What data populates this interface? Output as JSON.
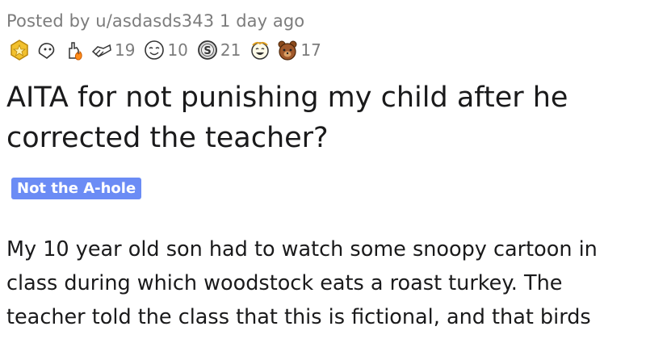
{
  "post": {
    "meta": "Posted by u/asdasds343 1 day ago",
    "title": "AITA for not punishing my child after he corrected the teacher?",
    "flair": "Not the A-hole",
    "body": "My 10 year old son had to watch some snoopy cartoon in class during which woodstock eats a roast turkey. The teacher told the class that this is fictional, and that birds"
  },
  "awards": [
    {
      "icon": "gold-award-icon",
      "count": ""
    },
    {
      "icon": "wholesome-award-icon",
      "count": ""
    },
    {
      "icon": "fire-hand-award-icon",
      "count": ""
    },
    {
      "icon": "helpful-award-icon",
      "count": "19"
    },
    {
      "icon": "face-award-icon",
      "count": "10"
    },
    {
      "icon": "silver-coin-award-icon",
      "count": "21"
    },
    {
      "icon": "laughing-face-award-icon",
      "count": ""
    },
    {
      "icon": "bear-award-icon",
      "count": "17"
    }
  ],
  "colors": {
    "flair_bg": "#6b8cf5",
    "meta_text": "#7c7c7c",
    "title_text": "#1a1a1b"
  }
}
